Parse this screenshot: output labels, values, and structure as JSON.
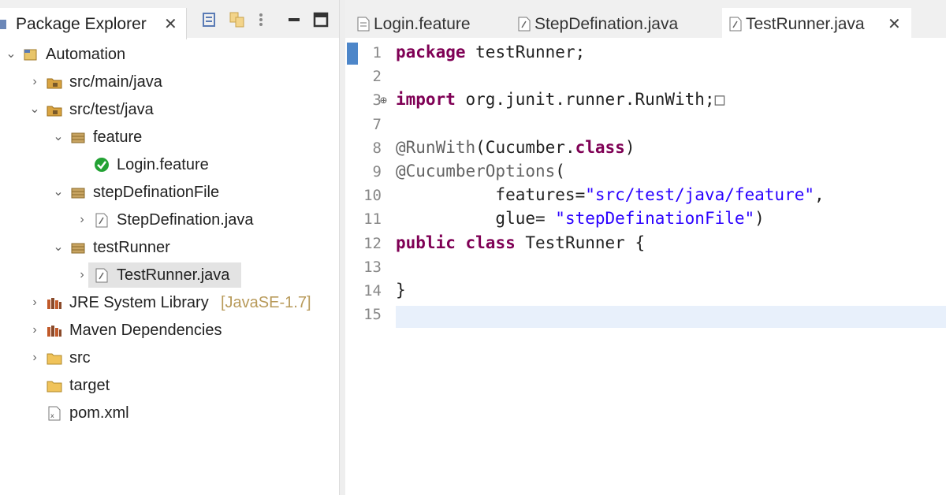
{
  "package_explorer": {
    "tab_label": "Package Explorer",
    "tree": [
      {
        "label": "Automation",
        "icon": "java-project-icon",
        "twisty": "expanded",
        "level": 0
      },
      {
        "label": "src/main/java",
        "icon": "source-folder-icon",
        "twisty": "collapsed",
        "level": 1
      },
      {
        "label": "src/test/java",
        "icon": "source-folder-icon",
        "twisty": "expanded",
        "level": 1
      },
      {
        "label": "feature",
        "icon": "package-icon",
        "twisty": "expanded",
        "level": 2
      },
      {
        "label": "Login.feature",
        "icon": "cucumber-feature-icon",
        "twisty": "none",
        "level": 3
      },
      {
        "label": "stepDefinationFile",
        "icon": "package-icon",
        "twisty": "expanded",
        "level": 2
      },
      {
        "label": "StepDefination.java",
        "icon": "java-file-icon",
        "twisty": "collapsed",
        "level": 3
      },
      {
        "label": "testRunner",
        "icon": "package-icon",
        "twisty": "expanded",
        "level": 2
      },
      {
        "label": "TestRunner.java",
        "icon": "java-file-icon",
        "twisty": "collapsed",
        "level": 3,
        "selected": true
      },
      {
        "label": "JRE System Library",
        "decoration": "[JavaSE-1.7]",
        "icon": "library-icon",
        "twisty": "collapsed",
        "level": 1
      },
      {
        "label": "Maven Dependencies",
        "icon": "library-icon",
        "twisty": "collapsed",
        "level": 1
      },
      {
        "label": "src",
        "icon": "folder-icon",
        "twisty": "collapsed",
        "level": 1
      },
      {
        "label": "target",
        "icon": "folder-icon",
        "twisty": "none",
        "level": 1
      },
      {
        "label": "pom.xml",
        "icon": "xml-file-icon",
        "twisty": "none",
        "level": 1
      }
    ]
  },
  "editor": {
    "tabs": [
      {
        "label": "Login.feature",
        "icon": "feature-file-icon",
        "active": false
      },
      {
        "label": "StepDefination.java",
        "icon": "java-file-icon",
        "active": false
      },
      {
        "label": "TestRunner.java",
        "icon": "java-file-icon",
        "active": true,
        "closable": true
      }
    ],
    "lines": [
      {
        "num": "1",
        "tokens": [
          {
            "t": "package",
            "c": "kw"
          },
          {
            "t": " testRunner;"
          }
        ]
      },
      {
        "num": "2",
        "tokens": []
      },
      {
        "num": "3",
        "fold": "⊕",
        "tokens": [
          {
            "t": "import",
            "c": "kw"
          },
          {
            "t": " org.junit.runner.RunWith;"
          },
          {
            "t": "□",
            "c": "ann"
          }
        ]
      },
      {
        "num": "7",
        "tokens": []
      },
      {
        "num": "8",
        "tokens": [
          {
            "t": "@RunWith",
            "c": "ann"
          },
          {
            "t": "(Cucumber."
          },
          {
            "t": "class",
            "c": "kw"
          },
          {
            "t": ")"
          }
        ]
      },
      {
        "num": "9",
        "tokens": [
          {
            "t": "@CucumberOptions",
            "c": "ann"
          },
          {
            "t": "("
          }
        ]
      },
      {
        "num": "10",
        "tokens": [
          {
            "t": "          features="
          },
          {
            "t": "\"src/test/java/feature\"",
            "c": "str"
          },
          {
            "t": ","
          }
        ]
      },
      {
        "num": "11",
        "tokens": [
          {
            "t": "          glue= "
          },
          {
            "t": "\"stepDefinationFile\"",
            "c": "str"
          },
          {
            "t": ")"
          }
        ]
      },
      {
        "num": "12",
        "tokens": [
          {
            "t": "public",
            "c": "kw"
          },
          {
            "t": " "
          },
          {
            "t": "class",
            "c": "kw"
          },
          {
            "t": " TestRunner {"
          }
        ]
      },
      {
        "num": "13",
        "tokens": []
      },
      {
        "num": "14",
        "tokens": [
          {
            "t": "}"
          }
        ]
      },
      {
        "num": "15",
        "tokens": [],
        "current": true
      }
    ]
  },
  "colors": {
    "keyword": "#7f0055",
    "annotation": "#646464",
    "string": "#2a00ff",
    "current_line": "#e8f0fb",
    "selection": "#e3e3e3"
  }
}
